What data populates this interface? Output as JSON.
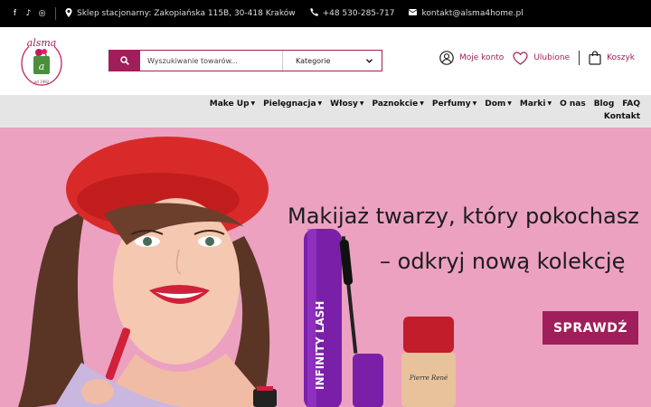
{
  "topbar": {
    "social_icons": [
      "facebook-icon",
      "tiktok-icon",
      "instagram-icon"
    ],
    "address": "Sklep stacjonarny: Zakopiańska 115B, 30-418 Kraków",
    "phone": "+48 530-285-717",
    "email": "kontakt@alsma4home.pl"
  },
  "logo": {
    "brand": "alsma",
    "since": "od 1992"
  },
  "search": {
    "placeholder": "Wyszukiwanie towarów...",
    "category": "Kategorie"
  },
  "header_links": {
    "account": "Moje konto",
    "favorites": "Ulubione",
    "cart": "Koszyk"
  },
  "nav": {
    "items": [
      {
        "label": "Make Up",
        "dropdown": true
      },
      {
        "label": "Pielęgnacja",
        "dropdown": true
      },
      {
        "label": "Włosy",
        "dropdown": true
      },
      {
        "label": "Paznokcie",
        "dropdown": true
      },
      {
        "label": "Perfumy",
        "dropdown": true
      },
      {
        "label": "Dom",
        "dropdown": true
      },
      {
        "label": "Marki",
        "dropdown": true
      },
      {
        "label": "O nas",
        "dropdown": false
      },
      {
        "label": "Blog",
        "dropdown": false
      },
      {
        "label": "FAQ",
        "dropdown": false
      }
    ],
    "second_row": "Kontakt"
  },
  "hero": {
    "title": "Makijaż twarzy, który pokochasz",
    "subtitle": "– odkryj nową kolekcję",
    "cta": "SPRAWDŹ",
    "mascara_text": "INFINITY LASH",
    "foundation_brand": "Pierre René"
  },
  "colors": {
    "accent": "#a01f5a",
    "hero_bg": "#eca1c0",
    "topbar_bg": "#000000",
    "nav_bg": "#e5e5e5"
  }
}
